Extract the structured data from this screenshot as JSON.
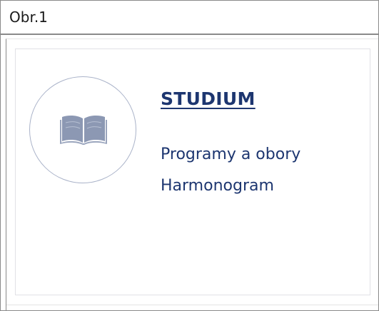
{
  "caption": "Obr.1",
  "card": {
    "icon": "book-icon",
    "title": "STUDIUM",
    "links": [
      "Programy a obory",
      "Harmonogram"
    ]
  },
  "colors": {
    "link": "#1d3670",
    "icon": "#8c98b3",
    "circle_border": "#aab3c9",
    "frame_border": "#8a8a8a"
  }
}
